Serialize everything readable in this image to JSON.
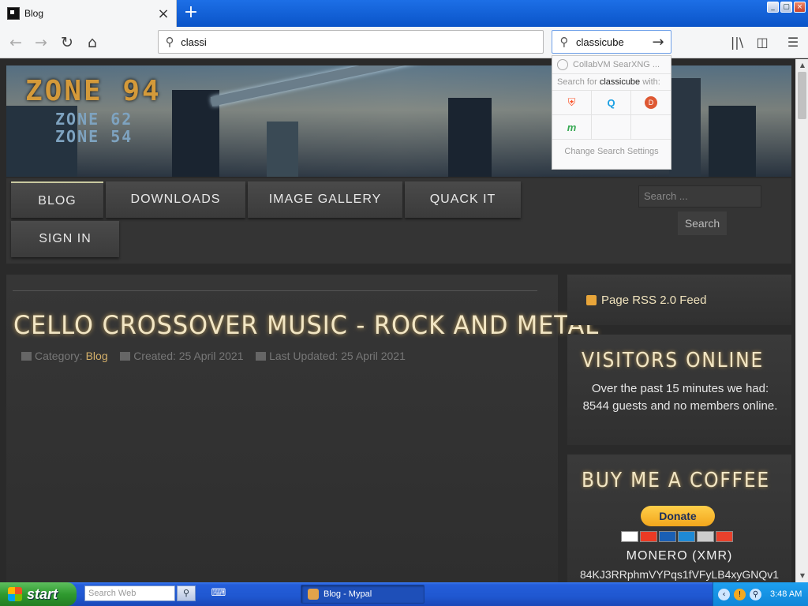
{
  "browser": {
    "tab_title": "Blog",
    "tab_close": "×",
    "new_tab": "+",
    "url_value": "classi",
    "search_value": "classicube",
    "window_controls": [
      "_",
      "▢",
      "×"
    ]
  },
  "search_dropdown": {
    "suggestion": "CollabVM SearXNG ...",
    "header_prefix": "Search for",
    "header_term": "classicube",
    "header_suffix": "with:",
    "engines": [
      "brave-icon",
      "qwant-icon",
      "duckduckgo-icon",
      "mojeek-icon"
    ],
    "settings_label": "Change Search Settings"
  },
  "site": {
    "logo_main": "ZONE 94",
    "logo_sub1": "ZONE 62",
    "logo_sub2": "ZONE 54",
    "menu": [
      "BLOG",
      "DOWNLOADS",
      "IMAGE GALLERY",
      "QUACK IT",
      "SIGN IN"
    ],
    "search_placeholder": "Search ...",
    "search_button": "Search"
  },
  "post": {
    "title": "CELLO CROSSOVER MUSIC - ROCK AND METAL",
    "category_label": "Category:",
    "category_value": "Blog",
    "created": "Created: 25 April 2021",
    "updated": "Last Updated: 25 April 2021"
  },
  "sidebar": {
    "rss_label": "Page RSS 2.0 Feed",
    "visitors_title": "VISITORS ONLINE",
    "visitors_text": "Over the past 15 minutes we had: 8544 guests and no members online.",
    "coffee_title": "BUY ME A COFFEE",
    "donate_label": "Donate",
    "monero_title": "MONERO (XMR)",
    "monero_address": "84KJ3RRphmVYPqs1fVFyLB4xyGNQv1"
  },
  "taskbar": {
    "start_label": "start",
    "search_placeholder": "Search Web",
    "task_label": "Blog - Mypal",
    "time": "3:48 AM"
  }
}
